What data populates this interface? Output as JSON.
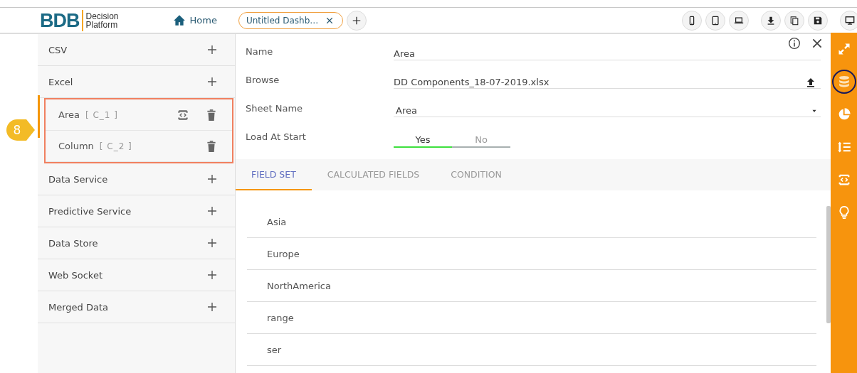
{
  "header": {
    "logo": {
      "mark": "BDB",
      "line1": "Decision",
      "line2": "Platform"
    },
    "home": "Home",
    "tabs": [
      {
        "label": "Untitled Dashb…",
        "selected": true
      }
    ]
  },
  "sidebar": {
    "groups": [
      {
        "label": "CSV"
      },
      {
        "label": "Excel",
        "children": [
          {
            "name": "Area",
            "tag": "[ C_1 ]",
            "script": true
          },
          {
            "name": "Column",
            "tag": "[ C_2 ]",
            "script": false
          }
        ]
      },
      {
        "label": "Data Service"
      },
      {
        "label": "Predictive Service"
      },
      {
        "label": "Data Store"
      },
      {
        "label": "Web Socket"
      },
      {
        "label": "Merged Data"
      }
    ],
    "step_badge": "8"
  },
  "form": {
    "fields": [
      {
        "kind": "text",
        "label": "Name",
        "value": "Area"
      },
      {
        "kind": "file",
        "label": "Browse",
        "value": "DD Components_18-07-2019.xlsx"
      },
      {
        "kind": "select",
        "label": "Sheet Name",
        "value": "Area"
      },
      {
        "kind": "toggle",
        "label": "Load At Start",
        "options": [
          {
            "label": "Yes",
            "selected": true
          },
          {
            "label": "No",
            "selected": false
          }
        ]
      }
    ]
  },
  "tabs": [
    {
      "label": "FIELD SET",
      "selected": true
    },
    {
      "label": "CALCULATED FIELDS",
      "selected": false
    },
    {
      "label": "CONDITION",
      "selected": false
    }
  ],
  "field_list": [
    "Asia",
    "Europe",
    "NorthAmerica",
    "range",
    "ser"
  ],
  "right_rail": [
    {
      "selected": false
    },
    {
      "selected": true
    },
    {
      "selected": false
    },
    {
      "selected": false
    },
    {
      "selected": false
    },
    {
      "selected": false
    }
  ]
}
